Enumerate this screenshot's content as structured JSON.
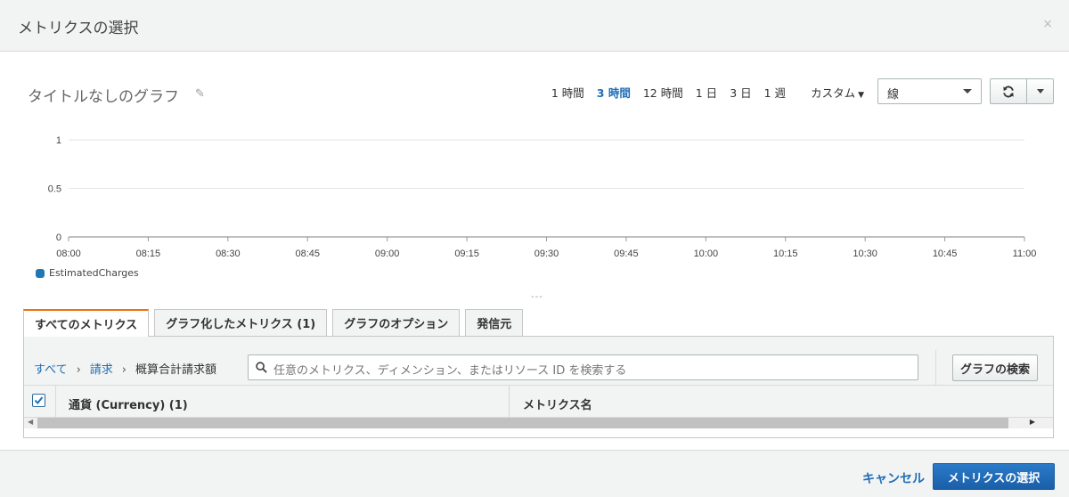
{
  "modal": {
    "title": "メトリクスの選択",
    "close": "×"
  },
  "graph": {
    "title": "タイトルなしのグラフ",
    "ranges": [
      "1 時間",
      "3 時間",
      "12 時間",
      "1 日",
      "3 日",
      "1 週"
    ],
    "active_range": "3 時間",
    "custom_label": "カスタム",
    "graph_type": "線"
  },
  "chart_data": {
    "type": "line",
    "x": [
      "08:00",
      "08:15",
      "08:30",
      "08:45",
      "09:00",
      "09:15",
      "09:30",
      "09:45",
      "10:00",
      "10:15",
      "10:30",
      "10:45",
      "11:00"
    ],
    "ylim": [
      0,
      1
    ],
    "yticks": [
      "1",
      "0.5",
      "0"
    ],
    "series": [
      {
        "name": "EstimatedCharges",
        "color": "#1f77b4",
        "values": []
      }
    ],
    "grid": true,
    "legend_position": "bottom-left"
  },
  "legend_dashes": "---",
  "tabs": [
    {
      "label": "すべてのメトリクス",
      "active": true
    },
    {
      "label": "グラフ化したメトリクス (1)",
      "active": false
    },
    {
      "label": "グラフのオプション",
      "active": false
    },
    {
      "label": "発信元",
      "active": false
    }
  ],
  "breadcrumb": {
    "all": "すべて",
    "billing": "請求",
    "current": "概算合計請求額",
    "sep": "›"
  },
  "search": {
    "placeholder": "任意のメトリクス、ディメンション、またはリソース ID を検索する",
    "button": "グラフの検索"
  },
  "table": {
    "col1": "通貨 (Currency) (1)",
    "col2": "メトリクス名"
  },
  "footer": {
    "cancel": "キャンセル",
    "confirm": "メトリクスの選択"
  }
}
